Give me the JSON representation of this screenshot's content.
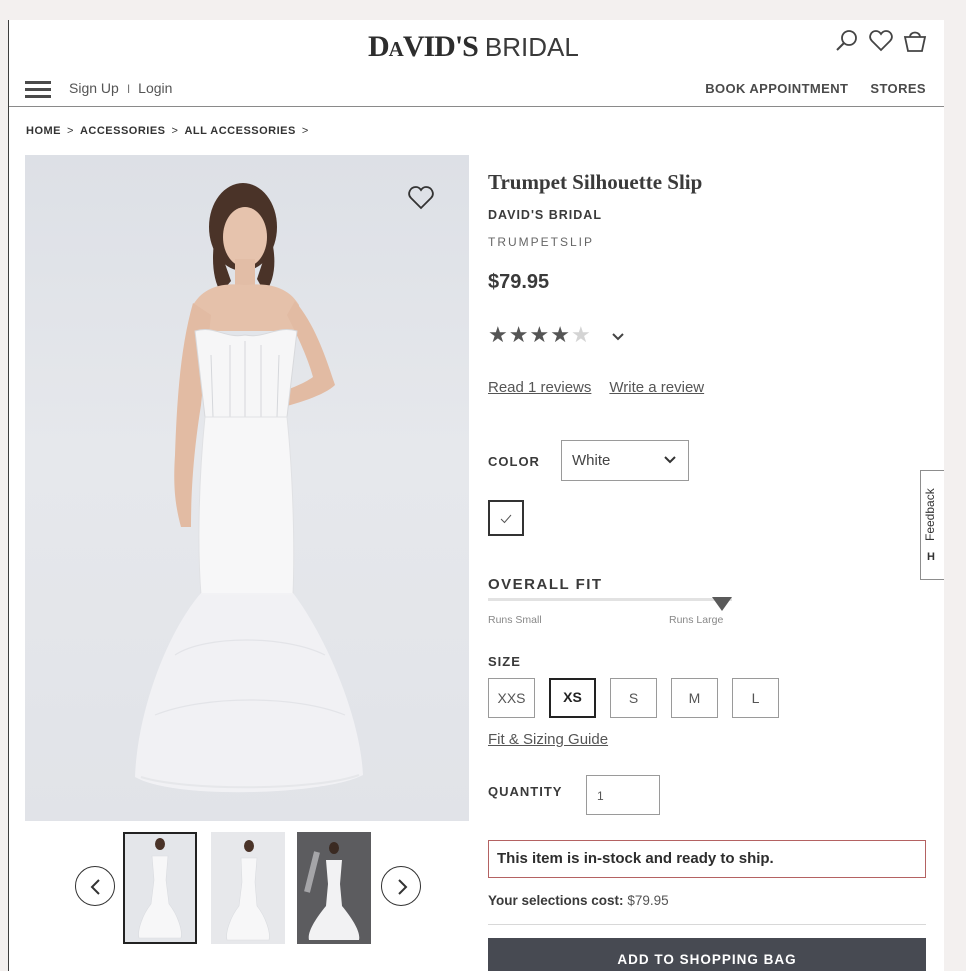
{
  "header": {
    "logo_bold": "DaVID'S",
    "logo_light": "BRIDAL",
    "icons": [
      "search-icon",
      "heart-icon",
      "shopping-bag-icon"
    ],
    "signup_label": "Sign Up",
    "separator": "I",
    "login_label": "Login",
    "nav": [
      "BOOK APPOINTMENT",
      "STORES"
    ]
  },
  "breadcrumb": [
    "HOME",
    "ACCESSORIES",
    "ALL ACCESSORIES"
  ],
  "breadcrumb_separator": ">",
  "product": {
    "title": "Trumpet Silhouette Slip",
    "brand": "DAVID'S BRIDAL",
    "sku": "TRUMPETSLIP",
    "price": "$79.95",
    "rating": 4,
    "rating_max": 5,
    "read_reviews": "Read 1 reviews",
    "write_review": "Write a review",
    "color_label": "COLOR",
    "color_value": "White",
    "fit_label": "OVERALL FIT",
    "fit_low": "Runs Small",
    "fit_high": "Runs Large",
    "fit_level": 0.94,
    "size_label": "SIZE",
    "sizes": [
      "XXS",
      "XS",
      "S",
      "M",
      "L"
    ],
    "selected_size": "XS",
    "fit_guide": "Fit & Sizing Guide",
    "quantity_label": "QUANTITY",
    "quantity": "1",
    "stock_message": "This item is in-stock and ready to ship.",
    "cost_label": "Your selections cost:",
    "cost_value": "$79.95",
    "add_button": "ADD TO SHOPPING BAG"
  },
  "feedback": {
    "label": "Feedback",
    "letter": "H"
  },
  "colors": {
    "button_bg": "#474a52",
    "stock_border": "#b46262",
    "image_bg": "#dde0e6"
  }
}
